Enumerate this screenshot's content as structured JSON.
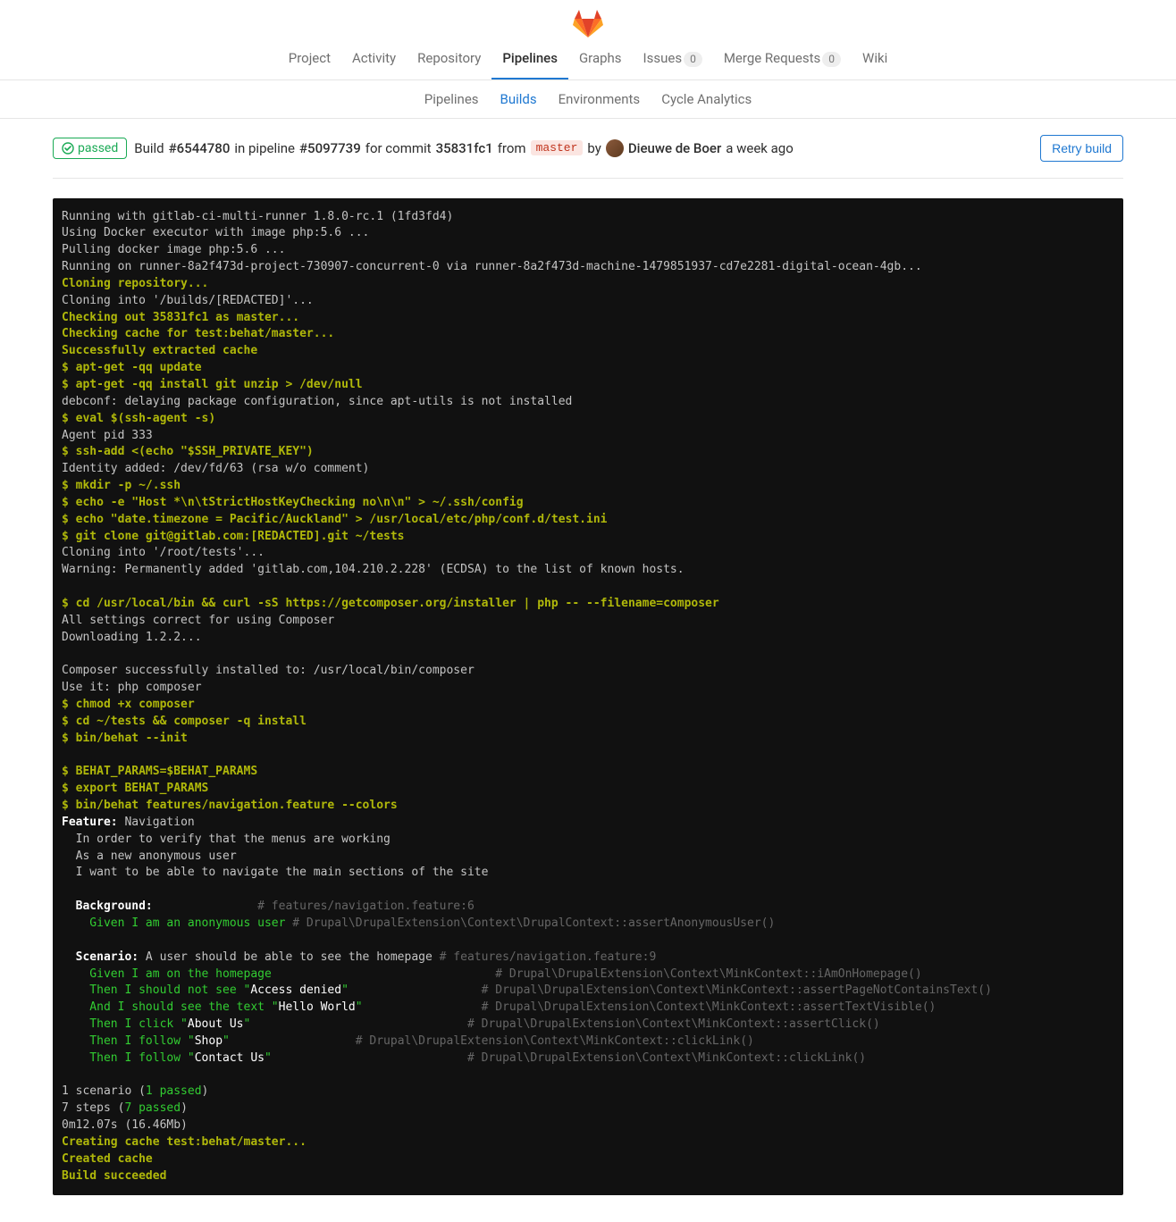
{
  "nav": {
    "main": [
      {
        "label": "Project",
        "active": false
      },
      {
        "label": "Activity",
        "active": false
      },
      {
        "label": "Repository",
        "active": false
      },
      {
        "label": "Pipelines",
        "active": true
      },
      {
        "label": "Graphs",
        "active": false
      },
      {
        "label": "Issues",
        "active": false,
        "count": "0"
      },
      {
        "label": "Merge Requests",
        "active": false,
        "count": "0"
      },
      {
        "label": "Wiki",
        "active": false
      }
    ],
    "sub": [
      {
        "label": "Pipelines",
        "active": false
      },
      {
        "label": "Builds",
        "active": true
      },
      {
        "label": "Environments",
        "active": false
      },
      {
        "label": "Cycle Analytics",
        "active": false
      }
    ]
  },
  "build_header": {
    "status": "passed",
    "build_word": "Build",
    "build_id": "#6544780",
    "in_pipeline": "in pipeline",
    "pipeline_id": "#5097739",
    "for_commit": "for commit",
    "commit_sha": "35831fc1",
    "from": "from",
    "ref": "master",
    "by": "by",
    "author": "Dieuwe de Boer",
    "time": "a week ago",
    "retry": "Retry build"
  },
  "log": {
    "l01": "Running with gitlab-ci-multi-runner 1.8.0-rc.1 (1fd3fd4)",
    "l02": "Using Docker executor with image php:5.6 ...",
    "l03": "Pulling docker image php:5.6 ...",
    "l04": "Running on runner-8a2f473d-project-730907-concurrent-0 via runner-8a2f473d-machine-1479851937-cd7e2281-digital-ocean-4gb...",
    "l05": "Cloning repository...",
    "l06": "Cloning into '/builds/[REDACTED]'...",
    "l07": "Checking out 35831fc1 as master...",
    "l08": "Checking cache for test:behat/master...",
    "l09": "Successfully extracted cache",
    "l10": "$ apt-get -qq update",
    "l11": "$ apt-get -qq install git unzip > /dev/null",
    "l12": "debconf: delaying package configuration, since apt-utils is not installed",
    "l13": "$ eval $(ssh-agent -s)",
    "l14": "Agent pid 333",
    "l15": "$ ssh-add <(echo \"$SSH_PRIVATE_KEY\")",
    "l16": "Identity added: /dev/fd/63 (rsa w/o comment)",
    "l17": "$ mkdir -p ~/.ssh",
    "l18": "$ echo -e \"Host *\\n\\tStrictHostKeyChecking no\\n\\n\" > ~/.ssh/config",
    "l19": "$ echo \"date.timezone = Pacific/Auckland\" > /usr/local/etc/php/conf.d/test.ini",
    "l20": "$ git clone git@gitlab.com:[REDACTED].git ~/tests",
    "l21": "Cloning into '/root/tests'...",
    "l22": "Warning: Permanently added 'gitlab.com,104.210.2.228' (ECDSA) to the list of known hosts.",
    "l23": "$ cd /usr/local/bin && curl -sS https://getcomposer.org/installer | php -- --filename=composer",
    "l24": "All settings correct for using Composer",
    "l25": "Downloading 1.2.2...",
    "l26": "Composer successfully installed to: /usr/local/bin/composer",
    "l27": "Use it: php composer",
    "l28": "$ chmod +x composer",
    "l29": "$ cd ~/tests && composer -q install",
    "l30": "$ bin/behat --init",
    "l31": "$ BEHAT_PARAMS=$BEHAT_PARAMS",
    "l32": "$ export BEHAT_PARAMS",
    "l33": "$ bin/behat features/navigation.feature --colors",
    "l34a": "Feature:",
    "l34b": " Navigation",
    "l35": "  In order to verify that the menus are working",
    "l36": "  As a new anonymous user",
    "l37": "  I want to be able to navigate the main sections of the site",
    "l38a": "  Background:",
    "l38b": "               # features/navigation.feature:6",
    "l39a": "    Given I am an anonymous user",
    "l39b": " # Drupal\\DrupalExtension\\Context\\DrupalContext::assertAnonymousUser()",
    "l40a": "  Scenario:",
    "l40b": " A user should be able to see the homepage",
    "l40c": " # features/navigation.feature:9",
    "l41a": "    Given I am on the homepage",
    "l41b": "                                # Drupal\\DrupalExtension\\Context\\MinkContext::iAmOnHomepage()",
    "l42a": "    Then I should not see \"",
    "l42q": "Access denied",
    "l42b": "\"",
    "l42c": "                   # Drupal\\DrupalExtension\\Context\\MinkContext::assertPageNotContainsText()",
    "l43a": "    And I should see the text \"",
    "l43q": "Hello World",
    "l43b": "\"",
    "l43c": "                 # Drupal\\DrupalExtension\\Context\\MinkContext::assertTextVisible()",
    "l44a": "    Then I click \"",
    "l44q": "About Us",
    "l44b": "\"",
    "l44c": "                               # Drupal\\DrupalExtension\\Context\\MinkContext::assertClick()",
    "l45a": "    Then I follow \"",
    "l45q": "Shop",
    "l45b": "\"",
    "l45c": "                  # Drupal\\DrupalExtension\\Context\\MinkContext::clickLink()",
    "l46a": "    Then I follow \"",
    "l46q": "Contact Us",
    "l46b": "\"",
    "l46c": "                            # Drupal\\DrupalExtension\\Context\\MinkContext::clickLink()",
    "l47a": "1 scenario (",
    "l47b": "1 passed",
    "l47c": ")",
    "l48a": "7 steps (",
    "l48b": "7 passed",
    "l48c": ")",
    "l49": "0m12.07s (16.46Mb)",
    "l50": "Creating cache test:behat/master...",
    "l51": "Created cache",
    "l52": "Build succeeded"
  }
}
